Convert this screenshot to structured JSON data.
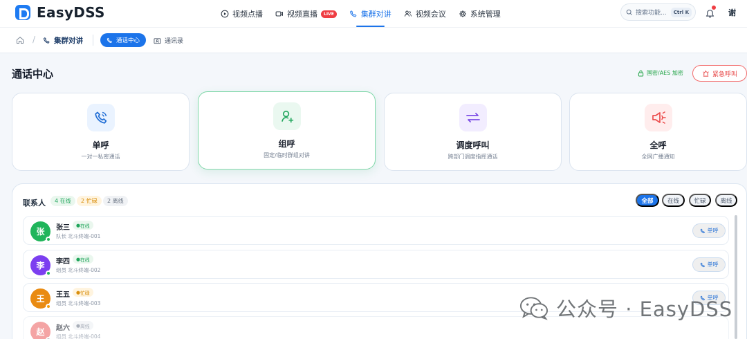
{
  "app": {
    "name": "EasyDSS",
    "user": "谢"
  },
  "nav": [
    {
      "label": "视频点播",
      "icon": "play-circle-icon",
      "active": false
    },
    {
      "label": "视频直播",
      "icon": "video-camera-icon",
      "active": false,
      "badge": "LIVE"
    },
    {
      "label": "集群对讲",
      "icon": "phone-icon",
      "active": true
    },
    {
      "label": "视频会议",
      "icon": "users-icon",
      "active": false
    },
    {
      "label": "系统管理",
      "icon": "gear-icon",
      "active": false
    }
  ],
  "search": {
    "placeholder": "搜索功能...",
    "shortcut": "Ctrl K"
  },
  "breadcrumb": {
    "section": "集群对讲",
    "current": "通话中心",
    "contacts": "通讯录"
  },
  "page": {
    "title": "通话中心",
    "secure_text": "国密/AES 加密",
    "emergency": "紧急呼叫"
  },
  "cards": [
    {
      "title": "单呼",
      "desc": "一对一私密通话",
      "color": "#2470d6",
      "bg": "#eaf3ff",
      "icon": "phone-icon"
    },
    {
      "title": "组呼",
      "desc": "固定/临时群组对讲",
      "color": "#21a65d",
      "bg": "#eaf8f0",
      "icon": "user-plus-icon"
    },
    {
      "title": "调度呼叫",
      "desc": "跨部门调度指挥通话",
      "color": "#7c4ce6",
      "bg": "#f2edff",
      "icon": "arrows-exchange-icon"
    },
    {
      "title": "全呼",
      "desc": "全网广播通知",
      "color": "#ec4d4d",
      "bg": "#ffeded",
      "icon": "speaker-icon"
    }
  ],
  "contacts": {
    "title": "联系人",
    "counts": {
      "online": "4 在线",
      "busy": "2 忙碌",
      "offline": "2 离线"
    },
    "filters": [
      "全部",
      "在线",
      "忙碌",
      "离线"
    ],
    "call_label": "单呼",
    "items": [
      {
        "initial": "张",
        "name": "张三",
        "status": "在线",
        "role": "队长",
        "device": "北斗终端-001",
        "avatar": "#20b55b",
        "status_color": "#20b55b"
      },
      {
        "initial": "李",
        "name": "李四",
        "status": "在线",
        "role": "组员",
        "device": "北斗终端-002",
        "avatar": "#7c3ff0",
        "status_color": "#20b55b"
      },
      {
        "initial": "王",
        "name": "王五",
        "status": "忙碌",
        "role": "组员",
        "device": "北斗终端-003",
        "avatar": "#e98b12",
        "status_color": "#f59e0b"
      },
      {
        "initial": "赵",
        "name": "赵六",
        "status": "离线",
        "role": "组员",
        "device": "北斗终端-004",
        "avatar": "#ef7a7a",
        "status_color": "#9ca3af"
      }
    ]
  },
  "watermark": "公众号 · EasyDSS"
}
